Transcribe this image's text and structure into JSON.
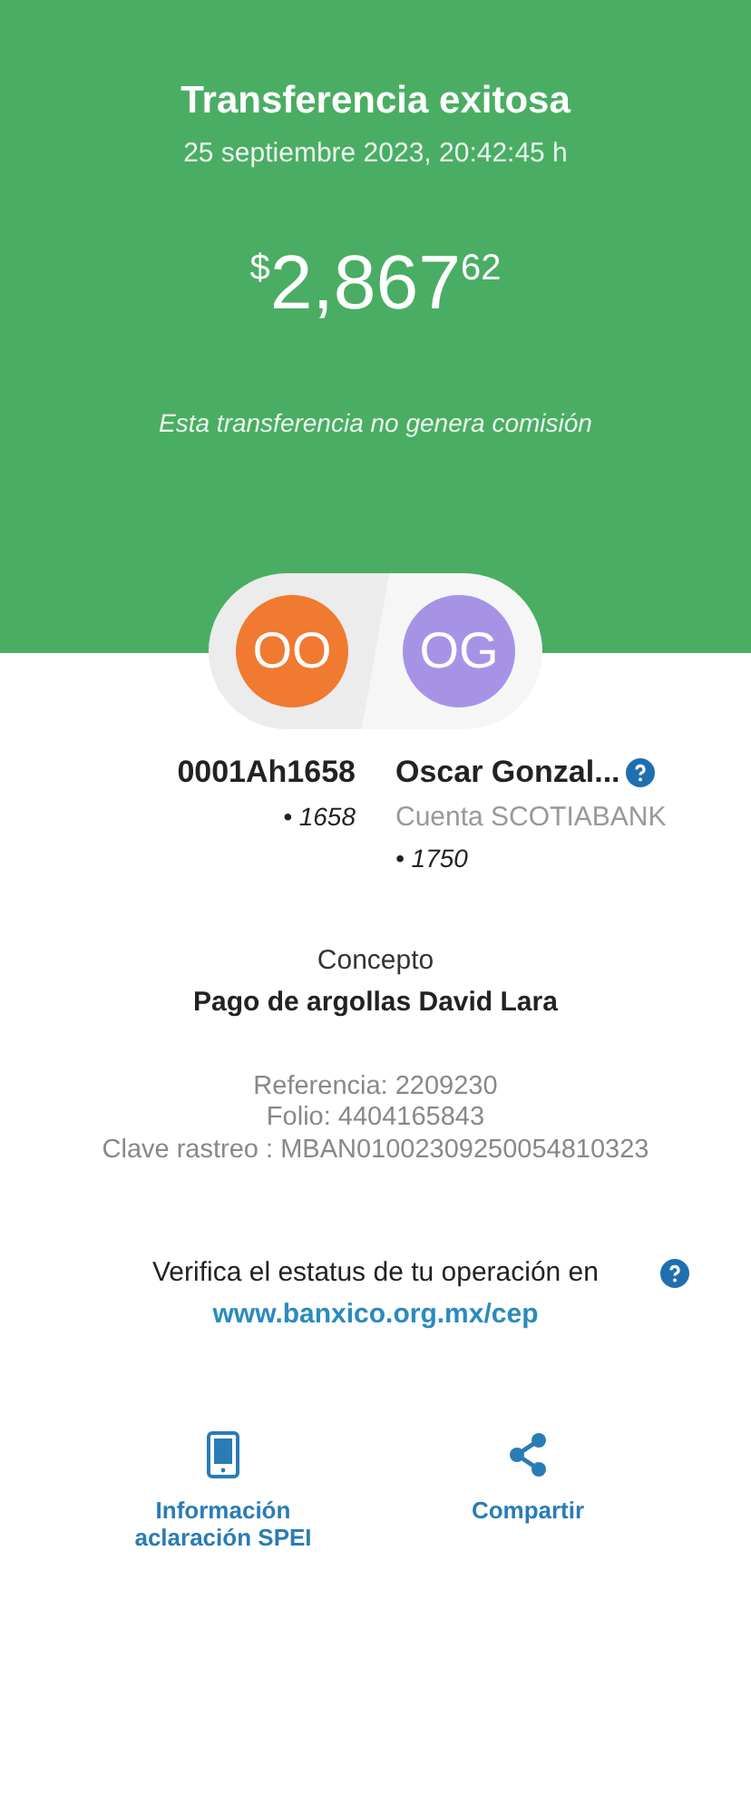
{
  "header": {
    "title": "Transferencia exitosa",
    "datetime": "25 septiembre 2023, 20:42:45 h",
    "amount": {
      "currency": "$",
      "integer": "2,867",
      "cents": "62"
    },
    "note": "Esta transferencia no genera comisión"
  },
  "parties": [
    {
      "initials": "OO",
      "color": "#f07a30",
      "name": "0001Ah1658",
      "account": "• 1658",
      "help": false
    },
    {
      "initials": "OG",
      "color": "#a793e6",
      "name": "Oscar Gonzal...",
      "bank": "Cuenta SCOTIABANK",
      "account": "• 1750",
      "help": true
    }
  ],
  "concept": {
    "label": "Concepto",
    "value": "Pago de argollas David Lara"
  },
  "details": [
    "Referencia: 2209230",
    "Folio: 4404165843",
    "Clave rastreo : MBAN01002309250054810323"
  ],
  "verify": {
    "text": "Verifica el estatus de tu operación en",
    "link": "www.banxico.org.mx/cep"
  },
  "actions": [
    {
      "kind": "phone",
      "label": "Información aclaración SPEI"
    },
    {
      "kind": "share",
      "label": "Compartir"
    }
  ]
}
